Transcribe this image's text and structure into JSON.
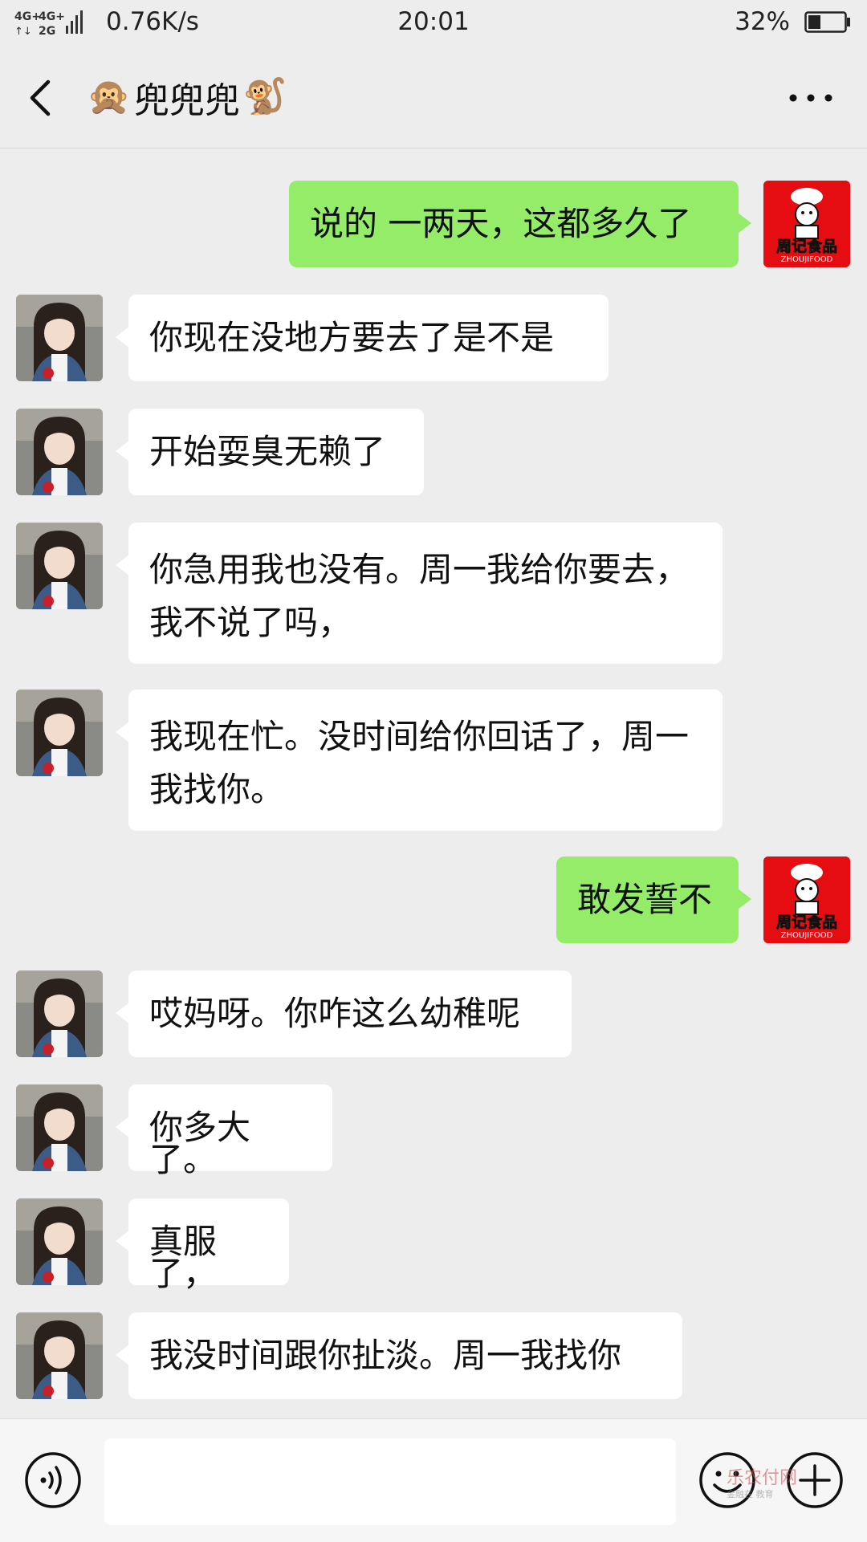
{
  "status_bar": {
    "network_1": "4G+",
    "network_2": "4G+",
    "network_3": "2G",
    "speed": "0.76K/s",
    "time": "20:01",
    "battery": "32%"
  },
  "header": {
    "title": "兜兜兜",
    "emoji_left": "🙊",
    "emoji_right": "🐒"
  },
  "messages": [
    {
      "side": "me",
      "text": "说的 一两天，这都多久了"
    },
    {
      "side": "them",
      "text": "你现在没地方要去了是不是"
    },
    {
      "side": "them",
      "text": "开始耍臭无赖了"
    },
    {
      "side": "them",
      "text": "你急用我也没有。周一我给你要去，我不说了吗，"
    },
    {
      "side": "them",
      "text": "我现在忙。没时间给你回话了，周一我找你。"
    },
    {
      "side": "me",
      "text": "敢发誓不"
    },
    {
      "side": "them",
      "text": "哎妈呀。你咋这么幼稚呢"
    },
    {
      "side": "them",
      "text": "你多大了。"
    },
    {
      "side": "them",
      "text": "真服了，"
    },
    {
      "side": "them",
      "text": "我没时间跟你扯淡。周一我找你"
    }
  ],
  "my_avatar": {
    "line1": "周记食品",
    "line2": "ZHOUJIFOOD"
  },
  "watermark": {
    "main": "乐农付网",
    "sub": "金融在 教育"
  },
  "colors": {
    "background": "#ededed",
    "my_bubble": "#95ec69",
    "their_bubble": "#ffffff",
    "avatar_red": "#e50d12"
  }
}
